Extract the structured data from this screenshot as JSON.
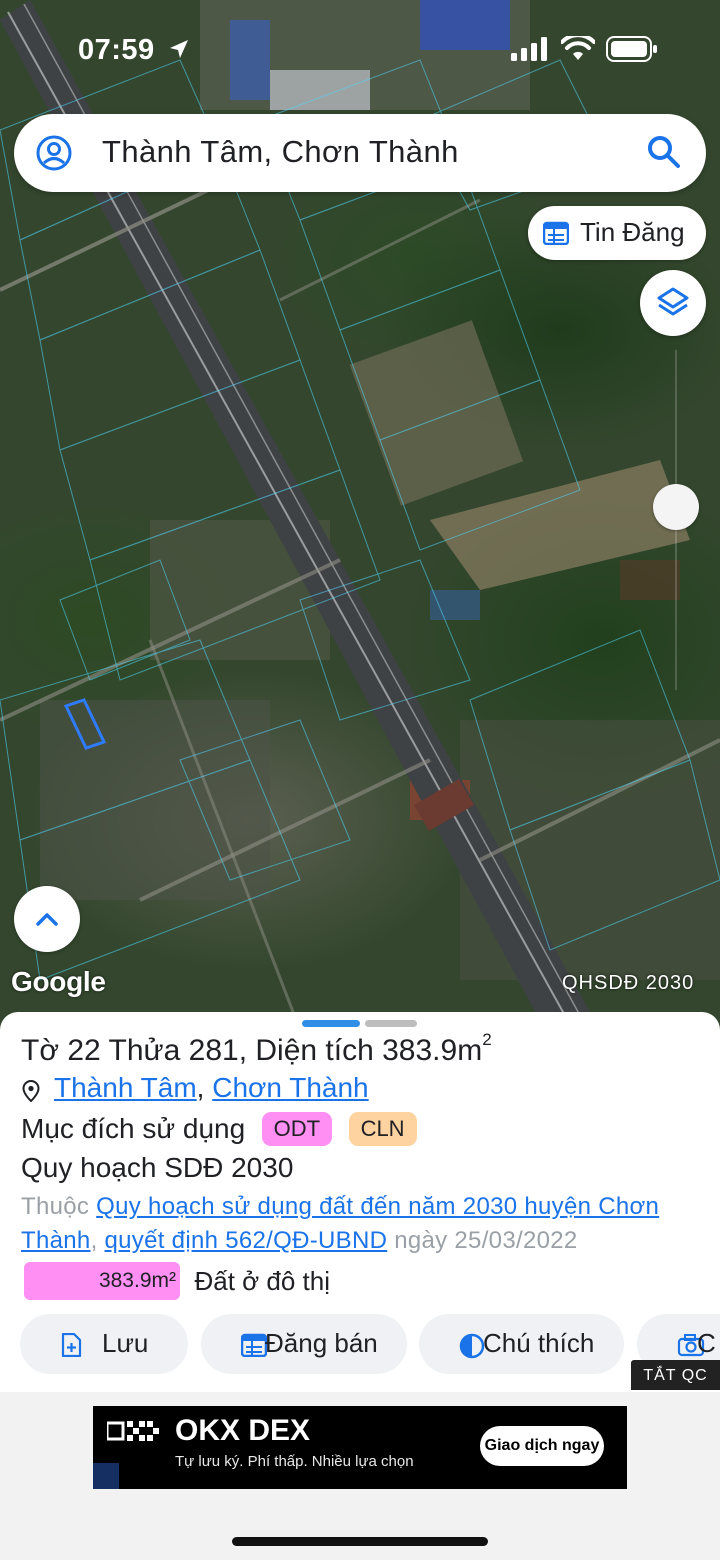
{
  "status_bar": {
    "time": "07:59"
  },
  "search": {
    "text": "Thành Tâm, Chơn Thành"
  },
  "map": {
    "tin_dang_label": "Tin Đăng",
    "google_logo": "Google",
    "map_layer_label": "QHSDĐ 2030"
  },
  "parcel": {
    "sheet_label": "Tờ",
    "sheet_no": "22",
    "plot_label": "Thửa",
    "plot_no": "281",
    "area_label": "Diện tích",
    "area_value": "383.9m",
    "area_unit_sup": "2",
    "location_ward": "Thành Tâm",
    "location_sep": ",",
    "location_district": "Chơn Thành",
    "purpose_label": "Mục đích sử dụng",
    "purpose_badges": [
      "ODT",
      "CLN"
    ],
    "plan_heading": "Quy hoạch SDĐ 2030",
    "plan_prefix": "Thuộc",
    "plan_link": "Quy hoạch sử dụng đất đến năm 2030 huyện Chơn Thành",
    "plan_sep": ",",
    "decision_link": "quyết định 562/QĐ-UBND",
    "decision_date": "ngày 25/03/2022",
    "area_pill": "383.9m²",
    "area_type": "Đất ở đô thị"
  },
  "actions": [
    {
      "label": "Lưu",
      "icon": "file-plus-icon"
    },
    {
      "label": "Đăng bán",
      "icon": "calendar-icon"
    },
    {
      "label": "Chú thích",
      "icon": "half-circle-icon"
    },
    {
      "label": "C",
      "icon": "camera-icon"
    }
  ],
  "ad": {
    "close_label": "TẮT QC",
    "title": "OKX DEX",
    "subtitle": "Tự lưu ký. Phí thấp. Nhiều lựa chọn",
    "cta": "Giao dịch ngay"
  },
  "colors": {
    "accent_blue": "#1a73e8",
    "odt_pink": "#ff8ff2",
    "cln_orange": "#ffd3a0"
  }
}
